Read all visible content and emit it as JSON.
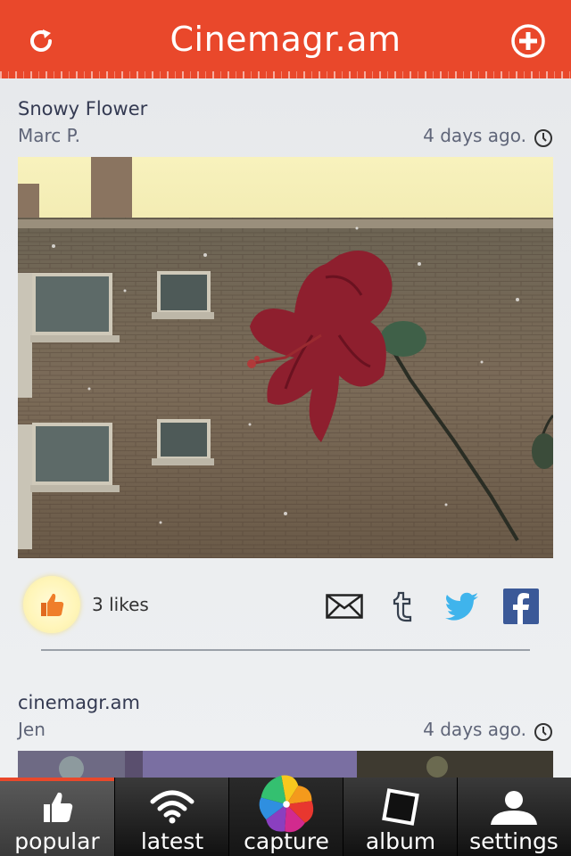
{
  "header": {
    "title": "Cinemagr.am",
    "refresh_icon": "refresh-icon",
    "add_icon": "plus-circle-icon",
    "color": "#e9482b"
  },
  "posts": [
    {
      "title": "Snowy Flower",
      "author": "Marc P.",
      "time": "4 days ago.",
      "likes": "3 likes"
    },
    {
      "title": "cinemagr.am",
      "author": "Jen",
      "time": "4 days ago."
    }
  ],
  "share": [
    "email-icon",
    "tumblr-icon",
    "twitter-icon",
    "facebook-icon"
  ],
  "tabs": [
    {
      "label": "popular",
      "icon": "thumbs-up-icon",
      "active": true
    },
    {
      "label": "latest",
      "icon": "wifi-icon"
    },
    {
      "label": "capture",
      "icon": "pinwheel-icon"
    },
    {
      "label": "album",
      "icon": "photo-frame-icon"
    },
    {
      "label": "settings",
      "icon": "person-icon"
    }
  ]
}
